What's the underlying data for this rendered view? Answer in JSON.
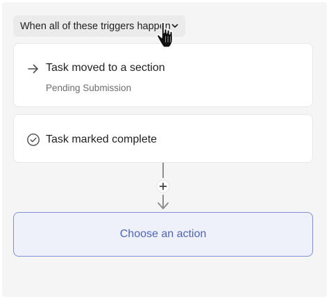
{
  "trigger_dropdown": {
    "label": "When all of these triggers happen",
    "icon": "chevron-down-icon"
  },
  "triggers": [
    {
      "icon": "arrow-right-icon",
      "title": "Task moved to a section",
      "subtitle": "Pending Submission"
    },
    {
      "icon": "check-circle-icon",
      "title": "Task marked complete"
    }
  ],
  "add_step": {
    "icon": "plus-icon"
  },
  "action": {
    "label": "Choose an action"
  },
  "colors": {
    "panel_bg": "#f6f5f5",
    "card_border": "#e8e7e7",
    "action_bg": "#eef0fa",
    "action_border": "#7e8fd6",
    "action_text": "#4f63b8",
    "connector": "#8d8e90"
  }
}
